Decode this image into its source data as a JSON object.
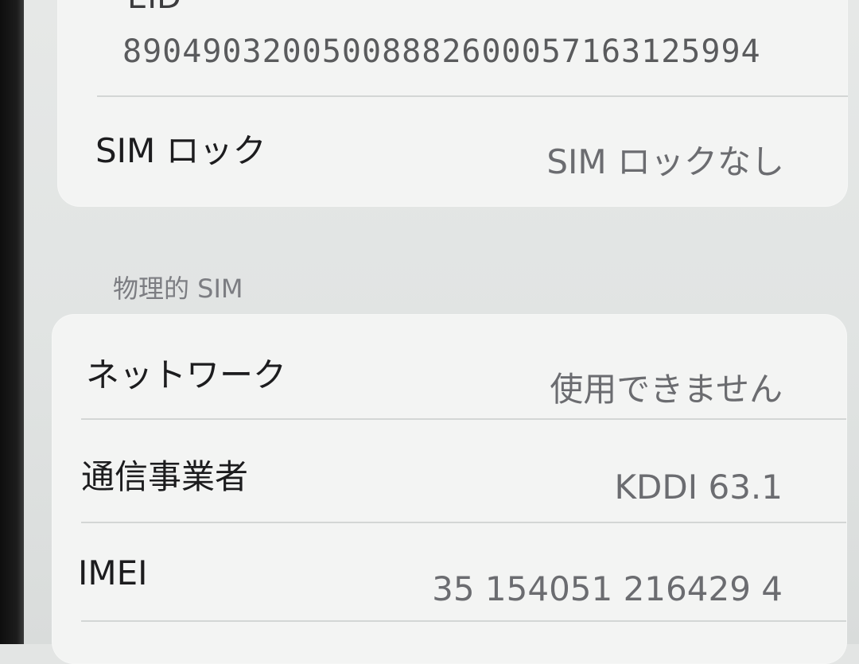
{
  "esim_card": {
    "eid_label": "EID",
    "eid_value": "89049032005008882600057163125994",
    "sim_lock_label": "SIM ロック",
    "sim_lock_value": "SIM ロックなし"
  },
  "physical_sim": {
    "header": "物理的 SIM",
    "rows": [
      {
        "label": "ネットワーク",
        "value": "使用できません"
      },
      {
        "label": "通信事業者",
        "value": "KDDI 63.1"
      },
      {
        "label": "IMEI",
        "value": "35 154051 216429 4"
      }
    ]
  }
}
